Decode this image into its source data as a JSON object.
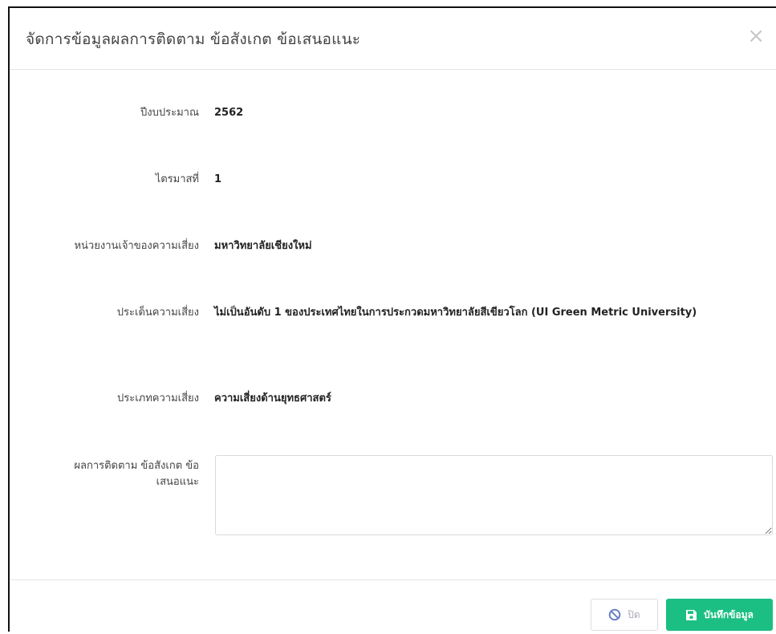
{
  "modal": {
    "title": "จัดการข้อมูลผลการติดตาม ข้อสังเกต ข้อเสนอแนะ",
    "close_symbol": "×"
  },
  "fields": {
    "fiscal_year": {
      "label": "ปีงบประมาณ",
      "value": "2562"
    },
    "quarter": {
      "label": "ไตรมาสที่",
      "value": "1"
    },
    "risk_owner": {
      "label": "หน่วยงานเจ้าของความเสี่ยง",
      "value": "มหาวิทยาลัยเชียงใหม่"
    },
    "risk_issue": {
      "label": "ประเด็นความเสี่ยง",
      "value": "ไม่เป็นอันดับ 1 ของประเทศไทยในการประกวดมหาวิทยาลัยสีเขียวโลก (UI Green Metric University)"
    },
    "risk_type": {
      "label": "ประเภทความเสี่ยง",
      "value": "ความเสี่ยงด้านยุทธศาสตร์"
    },
    "follow_up": {
      "label_line1": "ผลการติดตาม ข้อสังเกต ข้อ",
      "label_line2": "เสนอแนะ",
      "value": ""
    }
  },
  "footer": {
    "close_label": "ปิด",
    "save_label": "บันทึกข้อมูล"
  },
  "colors": {
    "save_button": "#1bbf84",
    "close_icon": "#6b7fc6"
  },
  "icons": {
    "close_button_icon": "ban-icon",
    "save_button_icon": "floppy-disk-icon"
  }
}
